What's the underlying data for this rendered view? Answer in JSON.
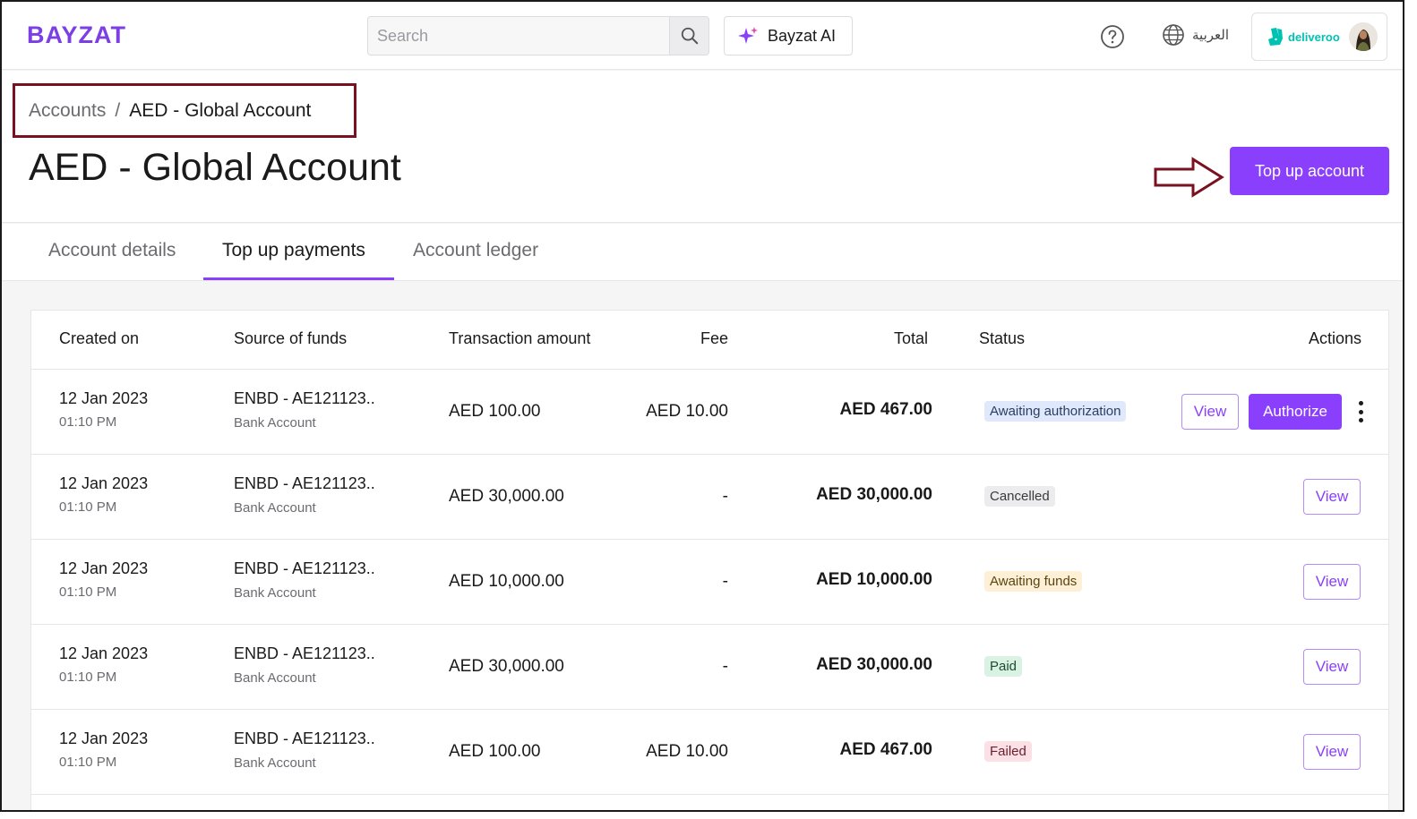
{
  "brand": {
    "logo": "BAYZAT",
    "accent": "#8a3ffc"
  },
  "topbar": {
    "search_placeholder": "Search",
    "ai_label": "Bayzat AI",
    "language_label": "العربية",
    "company_name": "deliveroo"
  },
  "breadcrumb": {
    "parent": "Accounts",
    "separator": "/",
    "current": "AED - Global Account"
  },
  "page": {
    "title": "AED - Global Account",
    "topup_label": "Top up account"
  },
  "tabs": [
    {
      "label": "Account details",
      "active": false
    },
    {
      "label": "Top up payments",
      "active": true
    },
    {
      "label": "Account ledger",
      "active": false
    }
  ],
  "table": {
    "headers": {
      "created_on": "Created on",
      "source": "Source of funds",
      "amount": "Transaction amount",
      "fee": "Fee",
      "total": "Total",
      "status": "Status",
      "actions": "Actions"
    },
    "view_label": "View",
    "authorize_label": "Authorize",
    "rows": [
      {
        "date": "12 Jan 2023",
        "time": "01:10 PM",
        "source": "ENBD - AE121123..",
        "source_type": "Bank Account",
        "amount": "AED 100.00",
        "fee": "AED 10.00",
        "total": "AED 467.00",
        "status": "Awaiting authorization"
      },
      {
        "date": "12 Jan 2023",
        "time": "01:10 PM",
        "source": "ENBD - AE121123..",
        "source_type": "Bank Account",
        "amount": "AED 30,000.00",
        "fee": "-",
        "total": "AED 30,000.00",
        "status": "Cancelled"
      },
      {
        "date": "12 Jan 2023",
        "time": "01:10 PM",
        "source": "ENBD - AE121123..",
        "source_type": "Bank Account",
        "amount": "AED 10,000.00",
        "fee": "-",
        "total": "AED 10,000.00",
        "status": "Awaiting funds"
      },
      {
        "date": "12 Jan 2023",
        "time": "01:10 PM",
        "source": "ENBD - AE121123..",
        "source_type": "Bank Account",
        "amount": "AED 30,000.00",
        "fee": "-",
        "total": "AED 30,000.00",
        "status": "Paid"
      },
      {
        "date": "12 Jan 2023",
        "time": "01:10 PM",
        "source": "ENBD - AE121123..",
        "source_type": "Bank Account",
        "amount": "AED 100.00",
        "fee": "AED 10.00",
        "total": "AED 467.00",
        "status": "Failed"
      }
    ]
  }
}
